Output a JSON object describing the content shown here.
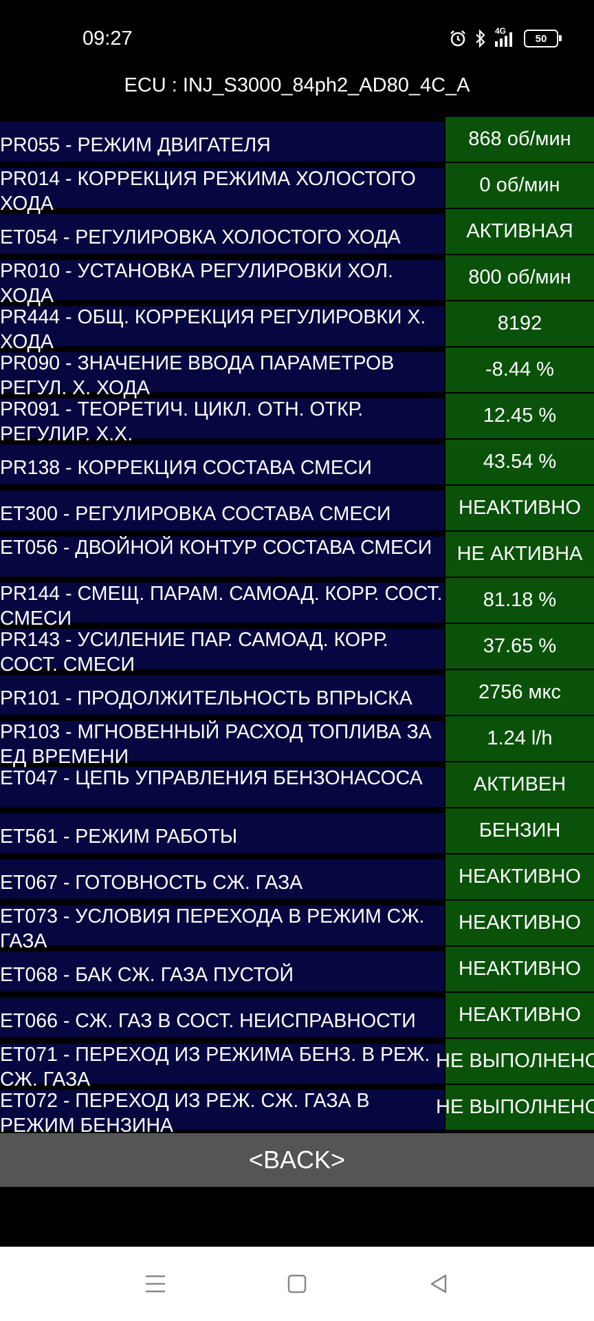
{
  "status_bar": {
    "time": "09:27",
    "network": "4G",
    "battery": "50",
    "icons": [
      "alarm-icon",
      "bluetooth-icon",
      "signal-icon",
      "battery-icon"
    ]
  },
  "ecu_title": "ECU : INJ_S3000_84ph2_AD80_4C_A",
  "rows": [
    {
      "name": "PR055 - РЕЖИМ ДВИГАТЕЛЯ",
      "value": "868 об/мин"
    },
    {
      "name": "PR014 - КОРРЕКЦИЯ РЕЖИМА ХОЛОСТОГО ХОДА",
      "value": "0 об/мин"
    },
    {
      "name": "ET054 - РЕГУЛИРОВКА ХОЛОСТОГО ХОДА",
      "value": "АКТИВНАЯ"
    },
    {
      "name": "PR010 - УСТАНОВКА РЕГУЛИРОВКИ ХОЛ. ХОДА",
      "value": "800 об/мин"
    },
    {
      "name": "PR444 - ОБЩ. КОРРЕКЦИЯ РЕГУЛИРОВКИ Х. ХОДА",
      "value": "8192"
    },
    {
      "name": "PR090 - ЗНАЧЕНИЕ ВВОДА ПАРАМЕТРОВ РЕГУЛ. Х. ХОДА",
      "value": "-8.44 %"
    },
    {
      "name": "PR091 - ТЕОРЕТИЧ. ЦИКЛ. ОТН. ОТКР. РЕГУЛИР. Х.Х.",
      "value": "12.45 %"
    },
    {
      "name": "PR138 - КОРРЕКЦИЯ СОСТАВА СМЕСИ",
      "value": "43.54 %"
    },
    {
      "name": "ET300 - РЕГУЛИРОВКА СОСТАВА СМЕСИ",
      "value": "НЕАКТИВНО"
    },
    {
      "name": "ET056 - ДВОЙНОЙ КОНТУР СОСТАВА СМЕСИ",
      "value": "НЕ АКТИВНА"
    },
    {
      "name": "PR144 - СМЕЩ. ПАРАМ. САМОАД. КОРР. СОСТ. СМЕСИ",
      "value": "81.18 %"
    },
    {
      "name": "PR143 - УСИЛЕНИЕ ПАР. САМОАД. КОРР. СОСТ. СМЕСИ",
      "value": "37.65 %"
    },
    {
      "name": "PR101 - ПРОДОЛЖИТЕЛЬНОСТЬ ВПРЫСКА",
      "value": "2756 мкс"
    },
    {
      "name": "PR103 - МГНОВЕННЫЙ РАСХОД ТОПЛИВА ЗА ЕД ВРЕМЕНИ",
      "value": "1.24 l/h"
    },
    {
      "name": "ET047 - ЦЕПЬ УПРАВЛЕНИЯ БЕНЗОНАСОСА",
      "value": "АКТИВЕН"
    },
    {
      "name": "ET561 - РЕЖИМ РАБОТЫ",
      "value": "БЕНЗИН"
    },
    {
      "name": "ET067 - ГОТОВНОСТЬ СЖ. ГАЗА",
      "value": "НЕАКТИВНО"
    },
    {
      "name": "ET073 - УСЛОВИЯ ПЕРЕХОДА В РЕЖИМ СЖ. ГАЗА",
      "value": "НЕАКТИВНО"
    },
    {
      "name": "ET068 - БАК СЖ. ГАЗА ПУСТОЙ",
      "value": "НЕАКТИВНО"
    },
    {
      "name": "ET066 - СЖ. ГАЗ В СОСТ. НЕИСПРАВНОСТИ",
      "value": "НЕАКТИВНО"
    },
    {
      "name": "ET071 - ПЕРЕХОД ИЗ РЕЖИМА БЕНЗ. В РЕЖ. СЖ. ГАЗА",
      "value": "НЕ ВЫПОЛНЕНО"
    },
    {
      "name": "ET072 - ПЕРЕХОД ИЗ РЕЖ. СЖ. ГАЗА В РЕЖИМ БЕНЗИНА",
      "value": "НЕ ВЫПОЛНЕНО"
    }
  ],
  "back_label": "<BACK>",
  "nav": [
    "menu-icon",
    "home-icon",
    "back-triangle-icon"
  ],
  "colors": {
    "name_bg": "#060640",
    "value_bg": "#0a520a",
    "button_bg": "#555555",
    "background": "#000000"
  }
}
